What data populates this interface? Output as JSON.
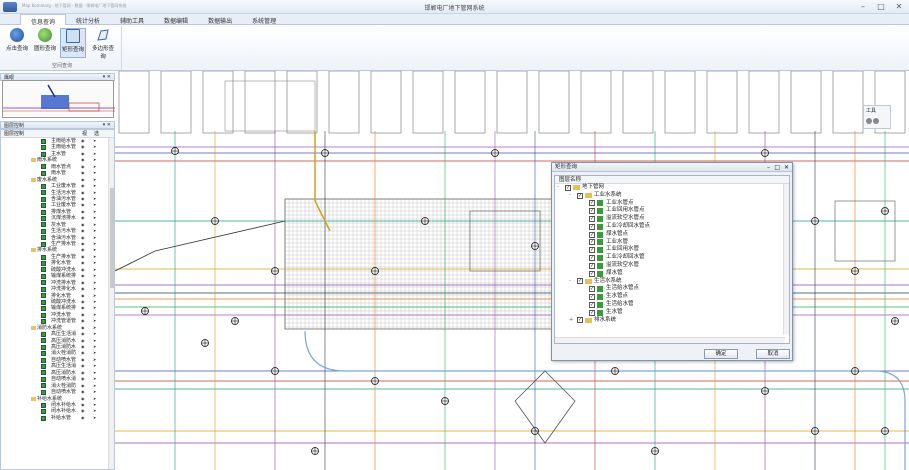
{
  "window": {
    "title": "邯郸电厂地下管网系统",
    "path": "Map Kommarg · 地下管网 · 数据 · 邯郸电厂地下管网系统"
  },
  "tabs": [
    "信息查询",
    "统计分析",
    "辅助工具",
    "数据编辑",
    "数据输出",
    "系统管理"
  ],
  "ribbon": {
    "buttons": [
      "点击查询",
      "圆形查询",
      "矩形查询",
      "多边形查询"
    ],
    "group_label": "空间查询"
  },
  "overview": {
    "title": "鹰眼"
  },
  "layer_control": {
    "title": "图层控制",
    "col_name": "图层控制",
    "col_visible": "视",
    "col_select": "选",
    "items": [
      {
        "label": "主雨给水管",
        "type": "leaf"
      },
      {
        "label": "主雨给水管",
        "type": "leaf"
      },
      {
        "label": "主水管",
        "type": "leaf"
      },
      {
        "label": "雨水系统",
        "type": "folder"
      },
      {
        "label": "雨水管点",
        "type": "leaf"
      },
      {
        "label": "雨水管",
        "type": "leaf"
      },
      {
        "label": "废水系统",
        "type": "folder"
      },
      {
        "label": "工业废水管",
        "type": "leaf"
      },
      {
        "label": "生活污水管",
        "type": "leaf"
      },
      {
        "label": "含油污水管",
        "type": "leaf"
      },
      {
        "label": "工业废水管",
        "type": "leaf"
      },
      {
        "label": "排煤水管",
        "type": "leaf"
      },
      {
        "label": "沉煤池排水",
        "type": "leaf"
      },
      {
        "label": "灰水管",
        "type": "leaf"
      },
      {
        "label": "生活污水管",
        "type": "leaf"
      },
      {
        "label": "含油污水管",
        "type": "leaf"
      },
      {
        "label": "生产排水管",
        "type": "leaf"
      },
      {
        "label": "排水系统",
        "type": "folder"
      },
      {
        "label": "生产排水管",
        "type": "leaf"
      },
      {
        "label": "排化水管",
        "type": "leaf"
      },
      {
        "label": "硫酸冲洗水",
        "type": "leaf"
      },
      {
        "label": "输煤系统排",
        "type": "leaf"
      },
      {
        "label": "冲洗排水管",
        "type": "leaf"
      },
      {
        "label": "冲洗排化水",
        "type": "leaf"
      },
      {
        "label": "排化水管",
        "type": "leaf"
      },
      {
        "label": "硫酸冲洗水",
        "type": "leaf"
      },
      {
        "label": "输煤系统排",
        "type": "leaf"
      },
      {
        "label": "冲洗水管",
        "type": "leaf"
      },
      {
        "label": "冲洗管道管",
        "type": "leaf"
      },
      {
        "label": "消防水系统",
        "type": "folder"
      },
      {
        "label": "高压生活消",
        "type": "leaf"
      },
      {
        "label": "高压消防水",
        "type": "leaf"
      },
      {
        "label": "高压消防水",
        "type": "leaf"
      },
      {
        "label": "消火栓消防",
        "type": "leaf"
      },
      {
        "label": "自动喷水管",
        "type": "leaf"
      },
      {
        "label": "高压生活消",
        "type": "leaf"
      },
      {
        "label": "高压消防水",
        "type": "leaf"
      },
      {
        "label": "自动喷水消",
        "type": "leaf"
      },
      {
        "label": "消火栓消防",
        "type": "leaf"
      },
      {
        "label": "自动喷水管",
        "type": "leaf"
      },
      {
        "label": "补给水系统",
        "type": "folder"
      },
      {
        "label": "闭水补给水",
        "type": "leaf"
      },
      {
        "label": "闭水补给水",
        "type": "leaf"
      },
      {
        "label": "补给水管",
        "type": "leaf"
      }
    ]
  },
  "toolbox": {
    "title": "工具"
  },
  "dialog": {
    "title": "矩形查询",
    "col_header": "图层名称",
    "rows": [
      {
        "label": "地下管网",
        "level": 0,
        "kind": "folder",
        "expander": "-"
      },
      {
        "label": "工业水系统",
        "level": 1,
        "kind": "folder",
        "expander": "-"
      },
      {
        "label": "工业水管点",
        "level": 2,
        "kind": "leaf"
      },
      {
        "label": "工业回用水管点",
        "level": 2,
        "kind": "leaf"
      },
      {
        "label": "溢流软空水管点",
        "level": 2,
        "kind": "leaf"
      },
      {
        "label": "工业冷却回水管点",
        "level": 2,
        "kind": "leaf"
      },
      {
        "label": "煤水管点",
        "level": 2,
        "kind": "leaf"
      },
      {
        "label": "工业水管",
        "level": 2,
        "kind": "leaf"
      },
      {
        "label": "工业回用水管",
        "level": 2,
        "kind": "leaf"
      },
      {
        "label": "工业冷却回水管",
        "level": 2,
        "kind": "leaf"
      },
      {
        "label": "溢流软空水管",
        "level": 2,
        "kind": "leaf"
      },
      {
        "label": "煤水管",
        "level": 2,
        "kind": "leaf"
      },
      {
        "label": "生活水系统",
        "level": 1,
        "kind": "folder",
        "expander": "-"
      },
      {
        "label": "生活给水管点",
        "level": 2,
        "kind": "leaf"
      },
      {
        "label": "生水管点",
        "level": 2,
        "kind": "leaf"
      },
      {
        "label": "生活给水管",
        "level": 2,
        "kind": "leaf"
      },
      {
        "label": "生水管",
        "level": 2,
        "kind": "leaf"
      },
      {
        "label": "排水系统",
        "level": 1,
        "kind": "folder",
        "expander": "+"
      }
    ],
    "ok": "确定",
    "cancel": "取消"
  }
}
